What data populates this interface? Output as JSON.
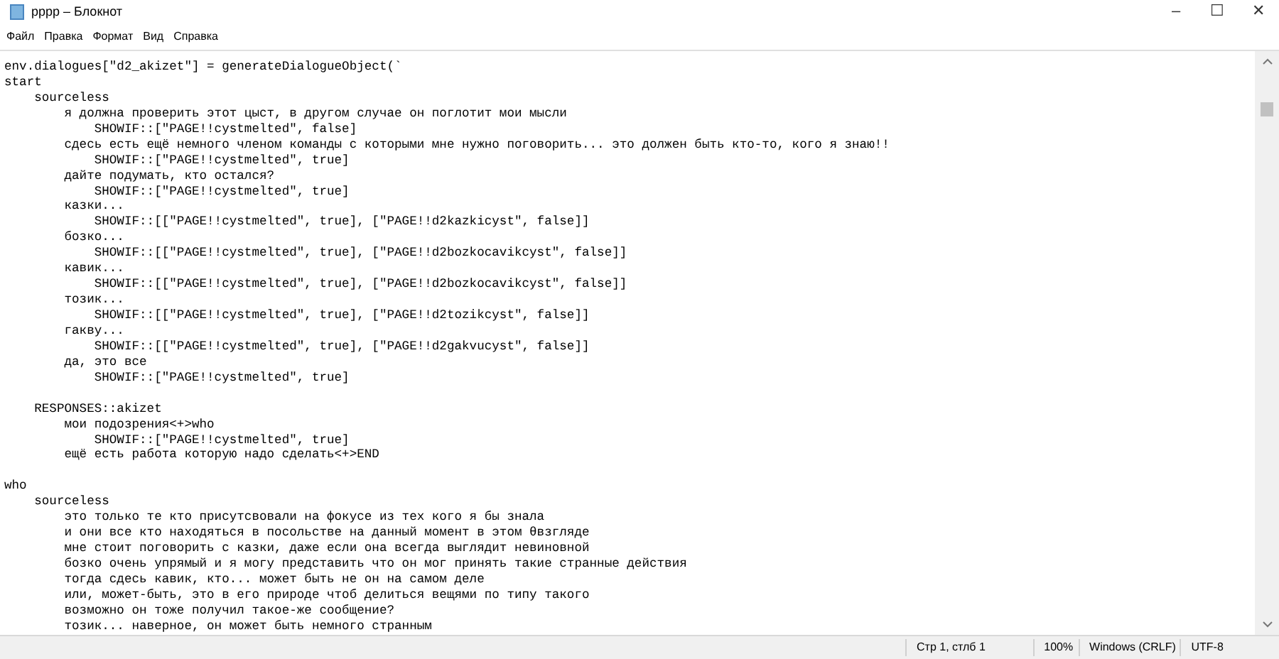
{
  "window": {
    "title": "pppp – Блокнот",
    "controls": [
      "–",
      "☐",
      "✕"
    ]
  },
  "menu": [
    "Файл",
    "Правка",
    "Формат",
    "Вид",
    "Справка"
  ],
  "editor": {
    "blocks": [
      [
        "env.dialogues[\"d2_akizet\"] = generateDialogueObject(`",
        "start",
        "    sourceless",
        "        я должна проверить этот цыст, в другом случае он поглотит мои мысли",
        "            SHOWIF::[\"PAGE!!cystmelted\", false]",
        "        сдесь есть ещё немного членом команды с которыми мне нужно поговорить... это должен быть кто-то, кого я знаю!!",
        "            SHOWIF::[\"PAGE!!cystmelted\", true]",
        "        дайте подумать, кто остался?",
        "            SHOWIF::[\"PAGE!!cystmelted\", true]",
        "        казки...",
        "            SHOWIF::[[\"PAGE!!cystmelted\", true], [\"PAGE!!d2kazkicyst\", false]]",
        "        бозко...",
        "            SHOWIF::[[\"PAGE!!cystmelted\", true], [\"PAGE!!d2bozkocavikcyst\", false]]",
        "        кавик...",
        "            SHOWIF::[[\"PAGE!!cystmelted\", true], [\"PAGE!!d2bozkocavikcyst\", false]]",
        "        тозик...",
        "            SHOWIF::[[\"PAGE!!cystmelted\", true], [\"PAGE!!d2tozikcyst\", false]]",
        "        гакву...",
        "            SHOWIF::[[\"PAGE!!cystmelted\", true], [\"PAGE!!d2gakvucyst\", false]]",
        "        да, это все",
        "            SHOWIF::[\"PAGE!!cystmelted\", true]"
      ],
      [
        "    RESPONSES::akizet",
        "        мои подозрения<+>who",
        "            SHOWIF::[\"PAGE!!cystmelted\", true]",
        "        ещё есть работа которую надо сделать<+>END"
      ],
      [
        "who",
        "    sourceless",
        "        это только те кто присутсвовали на фокусе из тех кого я бы знала",
        "        и они все кто находяться в посольстве на данный момент в этом θвзгляде",
        "        мне стоит поговорить с казки, даже если она всегда выглядит невиновной",
        "        бозко очень упрямый и я могу представить что он мог принять такие странные действия",
        "        тогда сдесь кавик, кто... может быть не он на самом деле",
        "        или, может-быть, это в его природе чтоб делиться вещями по типу такого",
        "        возможно он тоже получил такое-же сообщение?",
        "        тозик... наверное, он может быть немного странным"
      ]
    ]
  },
  "status_bar": [
    "Стр 1, стлб 1",
    "100%",
    "Windows (CRLF)",
    "UTF-8"
  ]
}
